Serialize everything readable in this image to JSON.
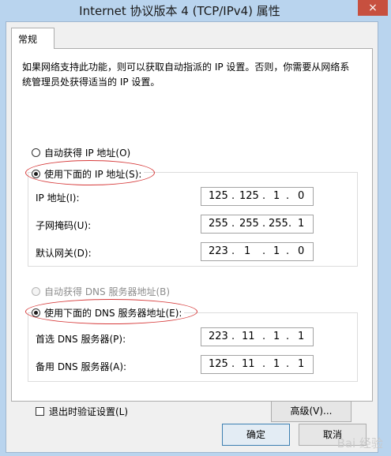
{
  "window": {
    "title": "Internet 协议版本 4 (TCP/IPv4) 属性",
    "close": "×"
  },
  "tab": {
    "label": "常规"
  },
  "description": "如果网络支持此功能，则可以获取自动指派的 IP 设置。否则，你需要从网络系统管理员处获得适当的 IP 设置。",
  "ip_mode": {
    "auto_label": "自动获得 IP 地址(O)",
    "manual_label": "使用下面的 IP 地址(S):"
  },
  "ip_fields": [
    {
      "label": "IP 地址(I):",
      "octets": [
        "125",
        "125",
        "1",
        "0"
      ]
    },
    {
      "label": "子网掩码(U):",
      "octets": [
        "255",
        "255",
        "255",
        "1"
      ]
    },
    {
      "label": "默认网关(D):",
      "octets": [
        "223",
        "1",
        "1",
        "0"
      ]
    }
  ],
  "dns_mode": {
    "auto_label": "自动获得 DNS 服务器地址(B)",
    "manual_label": "使用下面的 DNS 服务器地址(E):"
  },
  "dns_fields": [
    {
      "label": "首选 DNS 服务器(P):",
      "octets": [
        "223",
        "11",
        "1",
        "1"
      ]
    },
    {
      "label": "备用 DNS 服务器(A):",
      "octets": [
        "125",
        "11",
        "1",
        "1"
      ]
    }
  ],
  "validate_label": "退出时验证设置(L)",
  "advanced_label": "高级(V)...",
  "ok_label": "确定",
  "cancel_label": "取消",
  "watermark": "Bai 经验"
}
